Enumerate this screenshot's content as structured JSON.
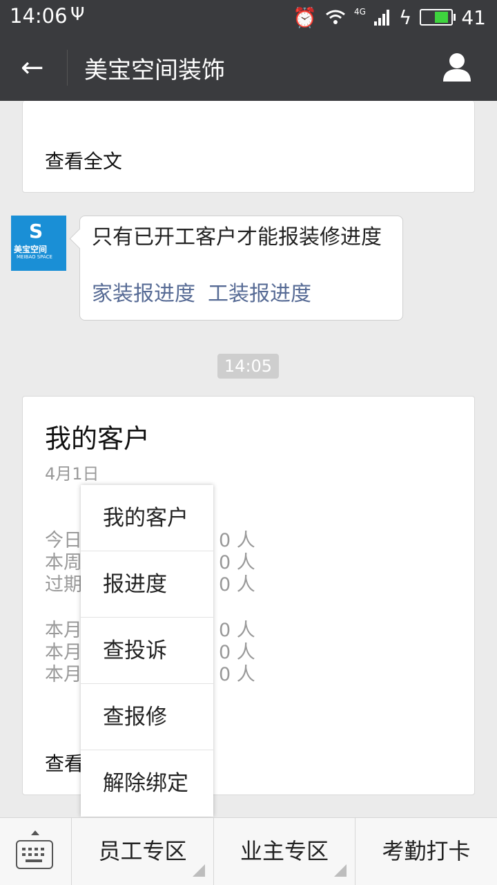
{
  "status_bar": {
    "time": "14:06",
    "battery": "41",
    "network": "4G"
  },
  "header": {
    "title": "美宝空间装饰"
  },
  "card1": {
    "read_more": "查看全文"
  },
  "bubble": {
    "text": "只有已开工客户才能报装修进度",
    "link_home": "家装报进度",
    "link_work": "工装报进度"
  },
  "timestamp": "14:05",
  "card2": {
    "title": "我的客户",
    "date": "4月1日",
    "stats": [
      {
        "label": "今日",
        "value": "0 人"
      },
      {
        "label": "本周",
        "value": "0 人"
      },
      {
        "label": "过期",
        "value": "0 人"
      },
      {
        "label": "本月",
        "value": "0 人"
      },
      {
        "label": "本月",
        "value": "0 人"
      },
      {
        "label": "本月",
        "value": "0 人"
      }
    ],
    "read_more": "查看"
  },
  "menu": {
    "items": [
      {
        "label": "我的客户"
      },
      {
        "label": "报进度"
      },
      {
        "label": "查投诉"
      },
      {
        "label": "查报修"
      },
      {
        "label": "解除绑定"
      }
    ]
  },
  "bottom_bar": {
    "btn1": "员工专区",
    "btn2": "业主专区",
    "btn3": "考勤打卡"
  },
  "avatar": {
    "name_cn": "美宝空间",
    "name_en": "MEIBAO SPACE"
  },
  "colors": {
    "header": "#3a3b3e",
    "link": "#576b95",
    "avatar": "#1a8fd6",
    "battery": "#3ed43e"
  }
}
